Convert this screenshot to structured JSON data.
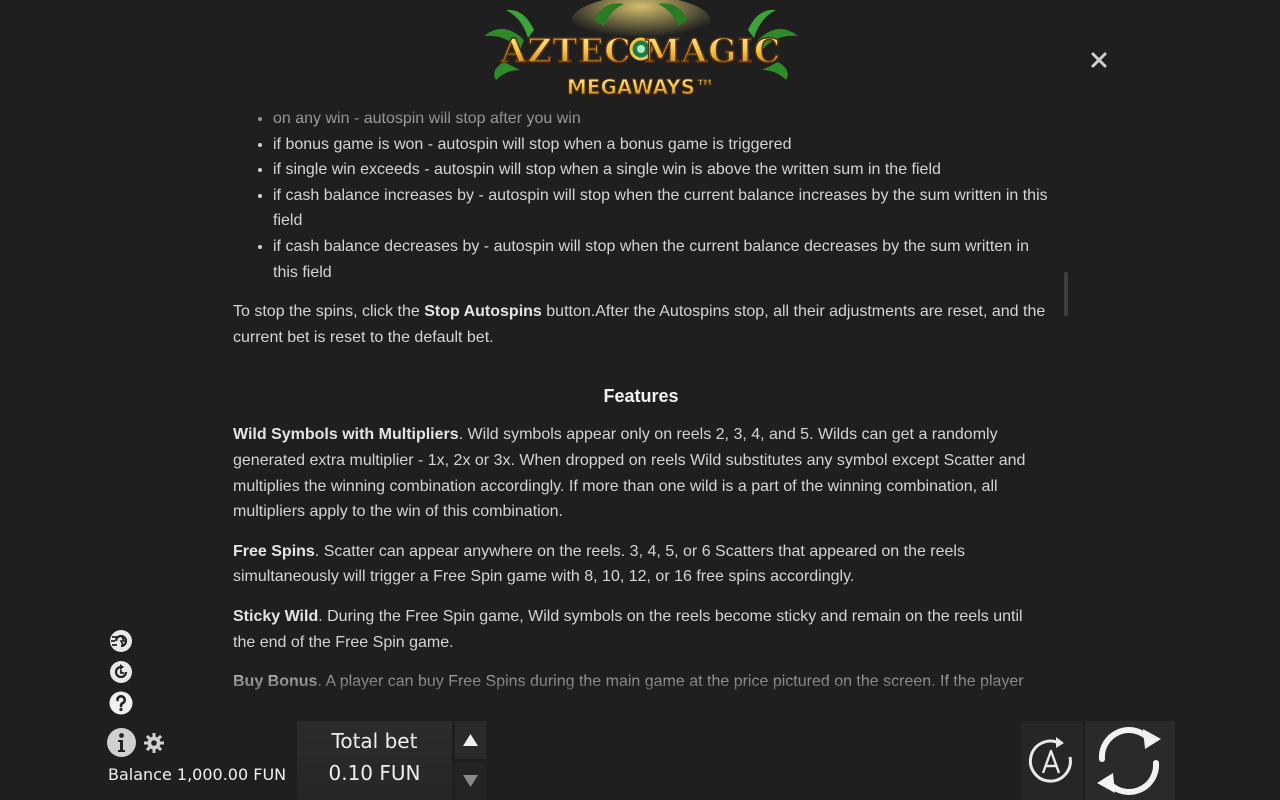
{
  "logo": {
    "title": "AZTEC MAGIC",
    "subtitle": "MEGAWAYS™"
  },
  "rules": {
    "autospin_options": [
      "on any win - autospin will stop after you win",
      "if bonus game is won - autospin will stop when a bonus game is triggered",
      "if single win exceeds - autospin will stop when a single win is above the written sum in the field",
      "if cash balance increases by - autospin will stop when the current balance increases by the sum written in this field",
      "if cash balance decreases by - autospin will stop when the current balance decreases by the sum written in this field"
    ],
    "stop_text_before": "To stop the spins, click the ",
    "stop_bold": "Stop Autospins",
    "stop_text_after": " button.After the Autospins stop, all their adjustments are reset, and the current bet is reset to the default bet.",
    "features_heading": "Features",
    "features": [
      {
        "title": "Wild Symbols with Multipliers",
        "text": ". Wild symbols appear only on reels 2, 3, 4, and 5. Wilds can get a randomly generated extra multiplier - 1x, 2x or 3x. When dropped on reels Wild substitutes any symbol except Scatter and multiplies the winning combination accordingly. If more than one wild is a part of the winning combination, all multipliers apply to the win of this combination."
      },
      {
        "title": "Free Spins",
        "text": ". Scatter can appear anywhere on the reels. 3, 4, 5, or 6 Scatters that appeared on the reels simultaneously will trigger a Free Spin game with 8, 10, 12, or 16 free spins accordingly."
      },
      {
        "title": "Sticky Wild",
        "text": ". During the Free Spin game, Wild symbols on the reels become sticky and remain on the reels until the end of the Free Spin game."
      },
      {
        "title": "Buy Bonus",
        "text": ". A player can buy Free Spins during the main game at the price pictured on the screen. If the player"
      }
    ]
  },
  "footer": {
    "balance_label": "Balance",
    "balance_value": "1,000.00 FUN",
    "total_bet_label": "Total bet",
    "total_bet_value": "0.10 FUN"
  },
  "icons": {
    "close": "close-icon",
    "turbo": "turbo-spin-icon",
    "history": "history-icon",
    "help": "help-icon",
    "info": "info-icon",
    "settings": "gear-icon",
    "bet_up": "arrow-up-icon",
    "bet_down": "arrow-down-icon",
    "autoplay": "autoplay-icon",
    "spin": "spin-icon"
  },
  "colors": {
    "background": "#1f1f1f",
    "text": "#d4d4d4",
    "logo_gold": "#f5c542",
    "logo_green": "#2f8a2a"
  }
}
